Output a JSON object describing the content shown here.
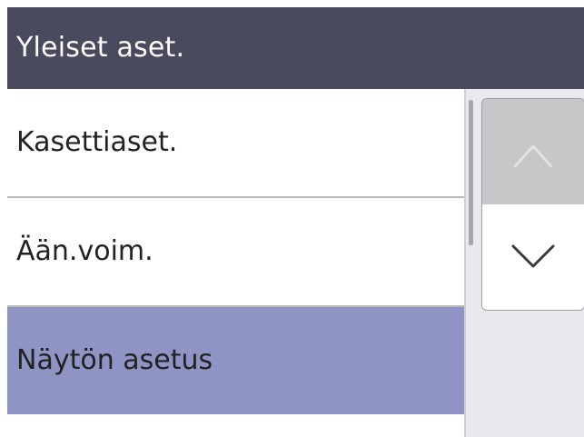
{
  "header": {
    "title": "Yleiset aset."
  },
  "menu": {
    "items": [
      {
        "label": "Kasettiaset."
      },
      {
        "label": "Ään.voim."
      },
      {
        "label": "Näytön asetus"
      }
    ],
    "selected_index": 2
  },
  "scroll": {
    "up_icon": "chevron-up-icon",
    "down_icon": "chevron-down-icon",
    "up_enabled": false,
    "down_enabled": true
  },
  "colors": {
    "header_bg": "#4a4a5e",
    "selected_bg": "#8e95c4",
    "panel_bg": "#e9e9ed",
    "disabled_button_bg": "#c7c7c9"
  }
}
